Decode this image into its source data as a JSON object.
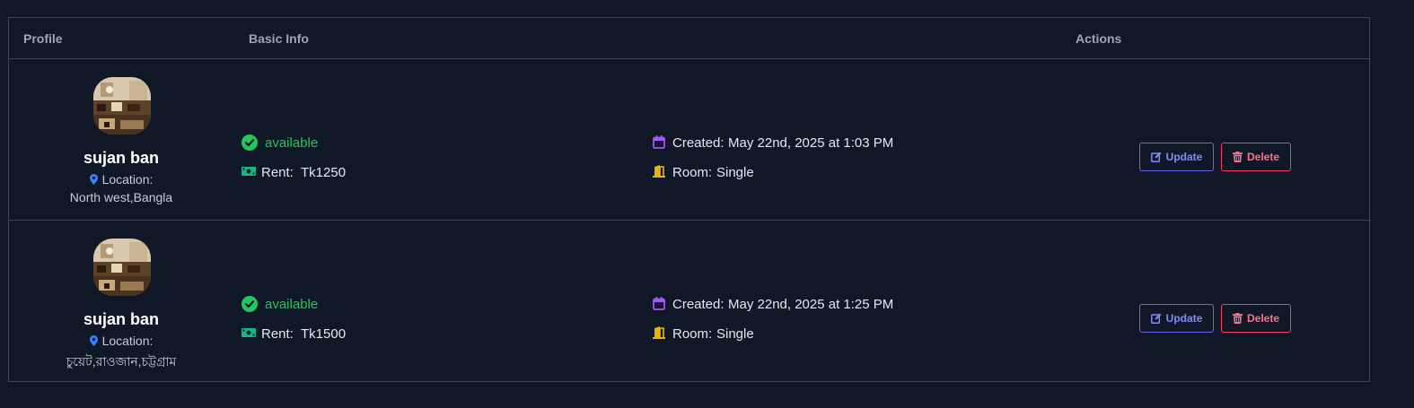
{
  "table": {
    "headers": {
      "profile": "Profile",
      "basic_info": "Basic Info",
      "actions": "Actions"
    },
    "rows": [
      {
        "name": "sujan ban",
        "location_label": "Location:",
        "location": "North west,Bangla",
        "status": "available",
        "rent_label": "Rent:",
        "rent": "Tk1250",
        "created_label": "Created:",
        "created": "May 22nd, 2025 at 1:03 PM",
        "room_label": "Room:",
        "room": "Single",
        "update_label": "Update",
        "delete_label": "Delete"
      },
      {
        "name": "sujan ban",
        "location_label": "Location:",
        "location": "চুয়েট,রাওজান,চট্টগ্রাম",
        "status": "available",
        "rent_label": "Rent:",
        "rent": "Tk1500",
        "created_label": "Created:",
        "created": "May 22nd, 2025 at 1:25 PM",
        "room_label": "Room:",
        "room": "Single",
        "update_label": "Update",
        "delete_label": "Delete"
      }
    ]
  },
  "icons": {
    "status": "check-circle-icon",
    "rent": "money-bill-icon",
    "created": "calendar-icon",
    "room": "door-icon",
    "location": "map-pin-icon",
    "update": "edit-icon",
    "delete": "trash-icon"
  },
  "colors": {
    "background": "#101827",
    "border": "#3b4658",
    "status_available": "#22c55e",
    "rent_icon": "#10b981",
    "calendar_icon": "#a855f7",
    "room_icon": "#eab308",
    "pin_icon": "#3b82f6",
    "update": "#6366f1",
    "delete": "#f43f5e"
  }
}
